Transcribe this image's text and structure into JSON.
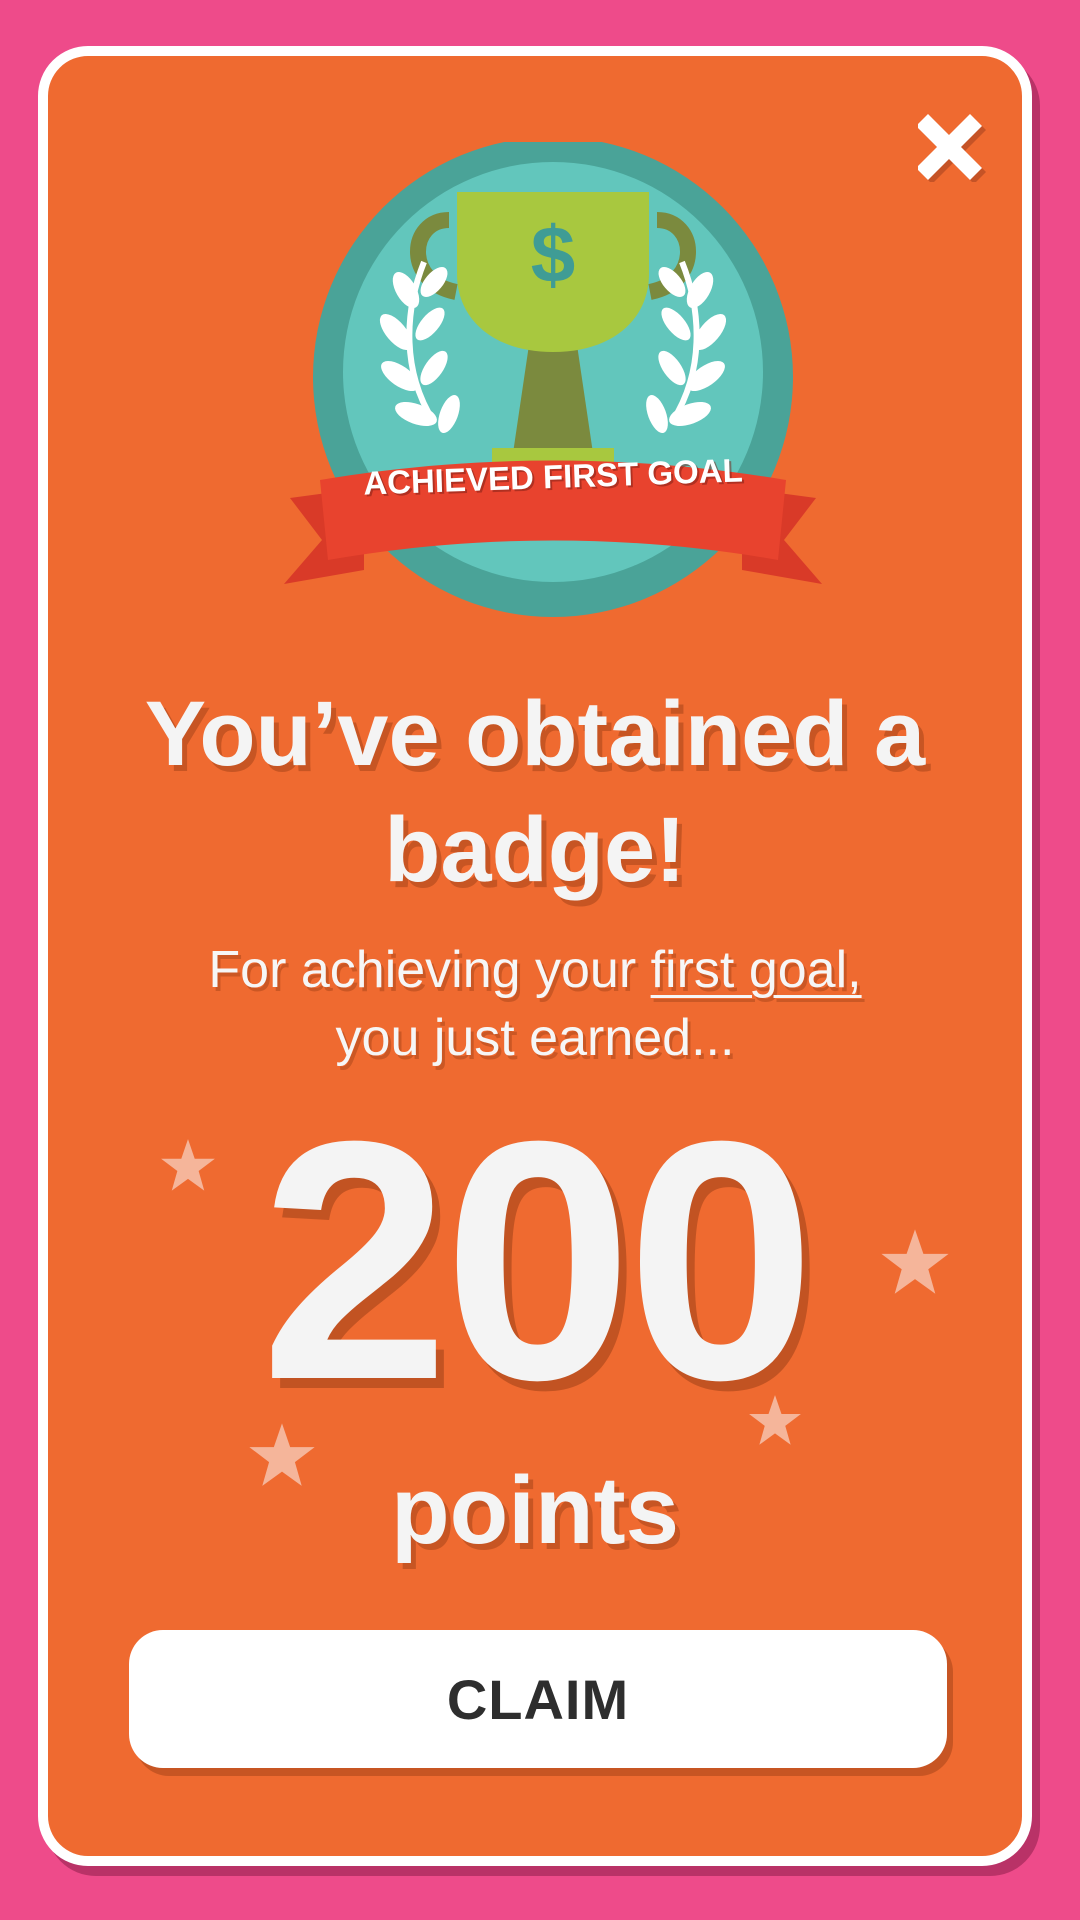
{
  "colors": {
    "background": "#EE4B8A",
    "card": "#EF6A30",
    "card_border": "#FFFFFF",
    "badge_outer": "#4AA398",
    "badge_inner": "#62C6BC",
    "trophy_cup": "#A8C83F",
    "trophy_stem": "#7B8A3E",
    "ribbon": "#E8432E",
    "star": "#F5B59A",
    "claim_text": "#2E2E2E"
  },
  "dialog": {
    "close_icon": "close-icon",
    "badge": {
      "icon": "trophy-icon",
      "ribbon_text": "ACHIEVED FIRST GOAL"
    },
    "headline_line1": "You’ve obtained a",
    "headline_line2": "badge!",
    "subtitle_prefix": "For achieving your ",
    "subtitle_link": "first goal,",
    "subtitle_line2": "you just earned...",
    "points_value": "200",
    "points_label": "points",
    "claim_label": "CLAIM"
  }
}
